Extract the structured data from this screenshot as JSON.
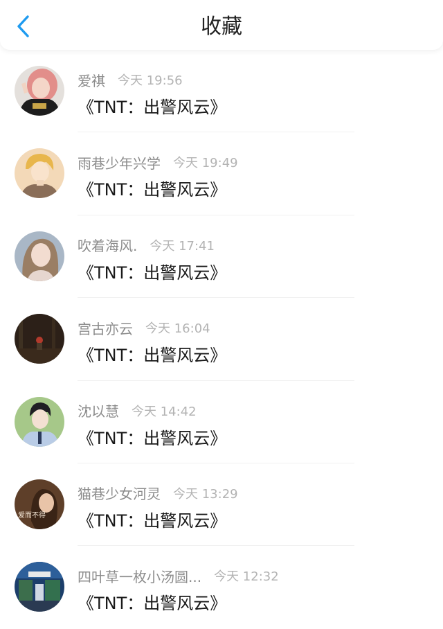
{
  "header": {
    "title": "收藏",
    "back_icon": "chevron-left-icon",
    "accent_color": "#1e9bf0"
  },
  "favorites": [
    {
      "user": "爱祺",
      "time": "今天 19:56",
      "content": "《TNT：出警风云》"
    },
    {
      "user": "雨巷少年兴学",
      "time": "今天 19:49",
      "content": "《TNT：出警风云》"
    },
    {
      "user": "吹着海风.",
      "time": "今天 17:41",
      "content": "《TNT：出警风云》"
    },
    {
      "user": "宫古亦云",
      "time": "今天 16:04",
      "content": "《TNT：出警风云》"
    },
    {
      "user": "沈以慧",
      "time": "今天 14:42",
      "content": "《TNT：出警风云》"
    },
    {
      "user": "猫巷少女河灵",
      "time": "今天 13:29",
      "content": "《TNT：出警风云》",
      "avatar_text": "爱而不得"
    },
    {
      "user": "四叶草一枚小汤圆...",
      "time": "今天 12:32",
      "content": "《TNT：出警风云》"
    }
  ]
}
